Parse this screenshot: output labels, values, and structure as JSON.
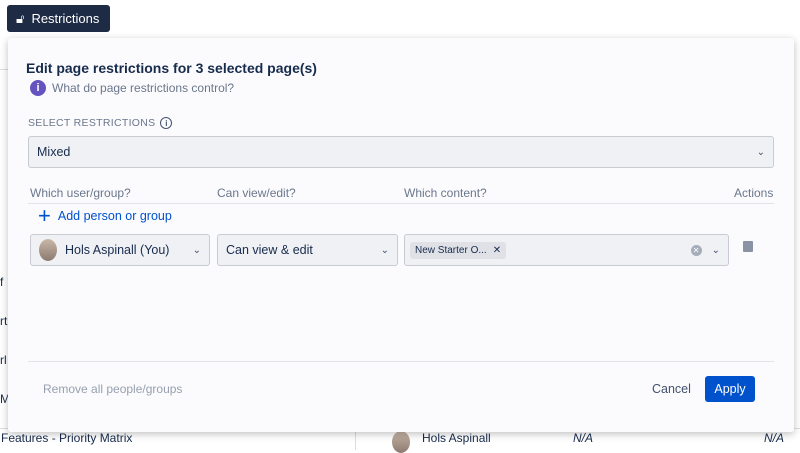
{
  "toolbar": {
    "restrictions_label": "Restrictions"
  },
  "modal": {
    "title": "Edit page restrictions for 3 selected page(s)",
    "help_link": "What do page restrictions control?",
    "select_label": "SELECT RESTRICTIONS",
    "select_value": "Mixed",
    "columns": [
      "Which user/group?",
      "Can view/edit?",
      "Which content?",
      "Actions"
    ],
    "add_label": "Add person or group",
    "row": {
      "user": "Hols Aspinall (You)",
      "permission": "Can view & edit",
      "content_chip": "New Starter O..."
    },
    "remove_all": "Remove all people/groups",
    "cancel": "Cancel",
    "apply": "Apply"
  },
  "background": {
    "left_fragments": [
      "f",
      "rt",
      "rl",
      "M"
    ],
    "bottom_row": {
      "title": "Features - Priority Matrix",
      "owner": "Hols Aspinall",
      "col1": "N/A",
      "col2": "N/A"
    }
  },
  "colors": {
    "primary": "#0052cc",
    "dark": "#1d2b45",
    "info": "#6554c0"
  }
}
